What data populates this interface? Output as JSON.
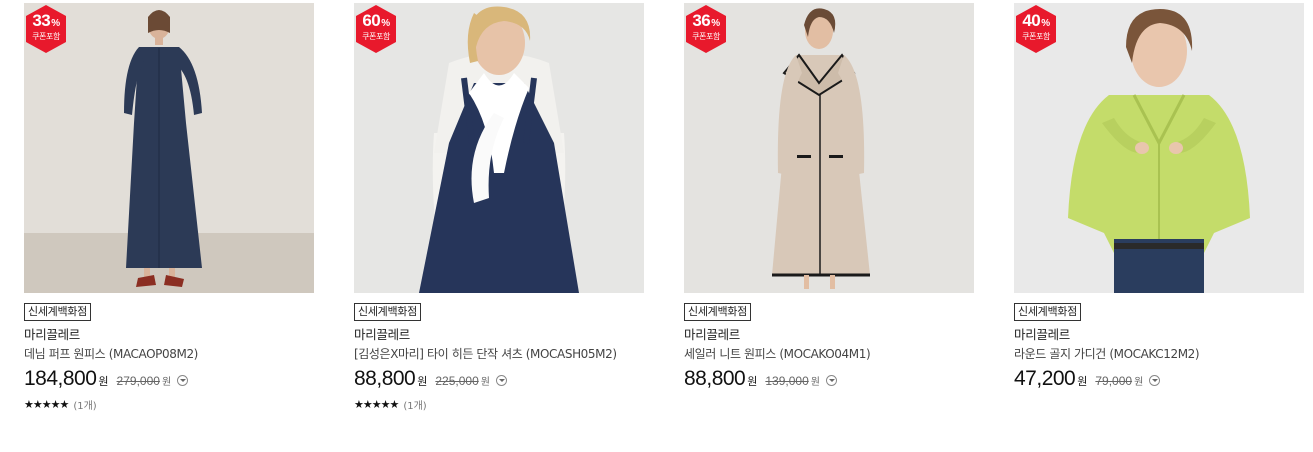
{
  "products": [
    {
      "discount": "33",
      "discount_unit": "%",
      "coupon_label": "쿠폰포함",
      "store": "신세계백화점",
      "brand": "마리끌레르",
      "name": "데님 퍼프 원피스 (MACAOP08M2)",
      "price": "184,800",
      "price_unit": "원",
      "original_price": "279,000",
      "original_unit": "원",
      "stars": "★★★★★",
      "review_count": "(1개)",
      "image_icon": "model-denim-dress"
    },
    {
      "discount": "60",
      "discount_unit": "%",
      "coupon_label": "쿠폰포함",
      "store": "신세계백화점",
      "brand": "마리끌레르",
      "name": "[김성은X마리] 타이 히든 단작 셔츠 (MOCASH05M2)",
      "price": "88,800",
      "price_unit": "원",
      "original_price": "225,000",
      "original_unit": "원",
      "stars": "★★★★★",
      "review_count": "(1개)",
      "image_icon": "model-tie-blouse-navy-dress"
    },
    {
      "discount": "36",
      "discount_unit": "%",
      "coupon_label": "쿠폰포함",
      "store": "신세계백화점",
      "brand": "마리끌레르",
      "name": "세일러 니트 원피스 (MOCAKO04M1)",
      "price": "88,800",
      "price_unit": "원",
      "original_price": "139,000",
      "original_unit": "원",
      "image_icon": "model-sailor-knit-dress"
    },
    {
      "discount": "40",
      "discount_unit": "%",
      "coupon_label": "쿠폰포함",
      "store": "신세계백화점",
      "brand": "마리끌레르",
      "name": "라운드 골지 가디건 (MOCAKC12M2)",
      "price": "47,200",
      "price_unit": "원",
      "original_price": "79,000",
      "original_unit": "원",
      "image_icon": "model-lime-cardigan"
    }
  ],
  "colors": {
    "badge_red": "#e8192c",
    "text_dark": "#111111",
    "text_muted": "#666666"
  }
}
